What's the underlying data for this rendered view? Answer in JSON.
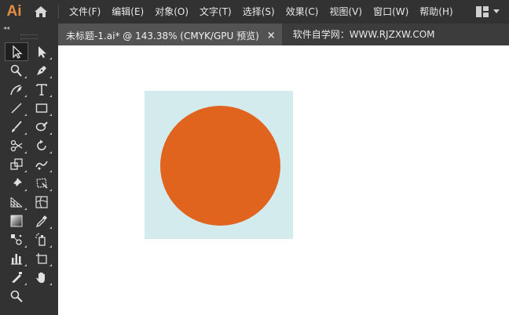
{
  "app": {
    "logo_text": "Ai"
  },
  "menu": {
    "items": [
      {
        "label": "文件(F)"
      },
      {
        "label": "编辑(E)"
      },
      {
        "label": "对象(O)"
      },
      {
        "label": "文字(T)"
      },
      {
        "label": "选择(S)"
      },
      {
        "label": "效果(C)"
      },
      {
        "label": "视图(V)"
      },
      {
        "label": "窗口(W)"
      },
      {
        "label": "帮助(H)"
      }
    ]
  },
  "tabbar": {
    "active_tab": "未标题-1.ai* @ 143.38% (CMYK/GPU 预览)",
    "close_glyph": "×",
    "watermark": "软件自学网：WWW.RJZXW.COM"
  },
  "toolbar": {
    "collapse_glyph": "◂◂"
  },
  "canvas": {
    "rect_fill": "#d4ebee",
    "circle_fill": "#e0641e",
    "background": "#ffffff"
  }
}
